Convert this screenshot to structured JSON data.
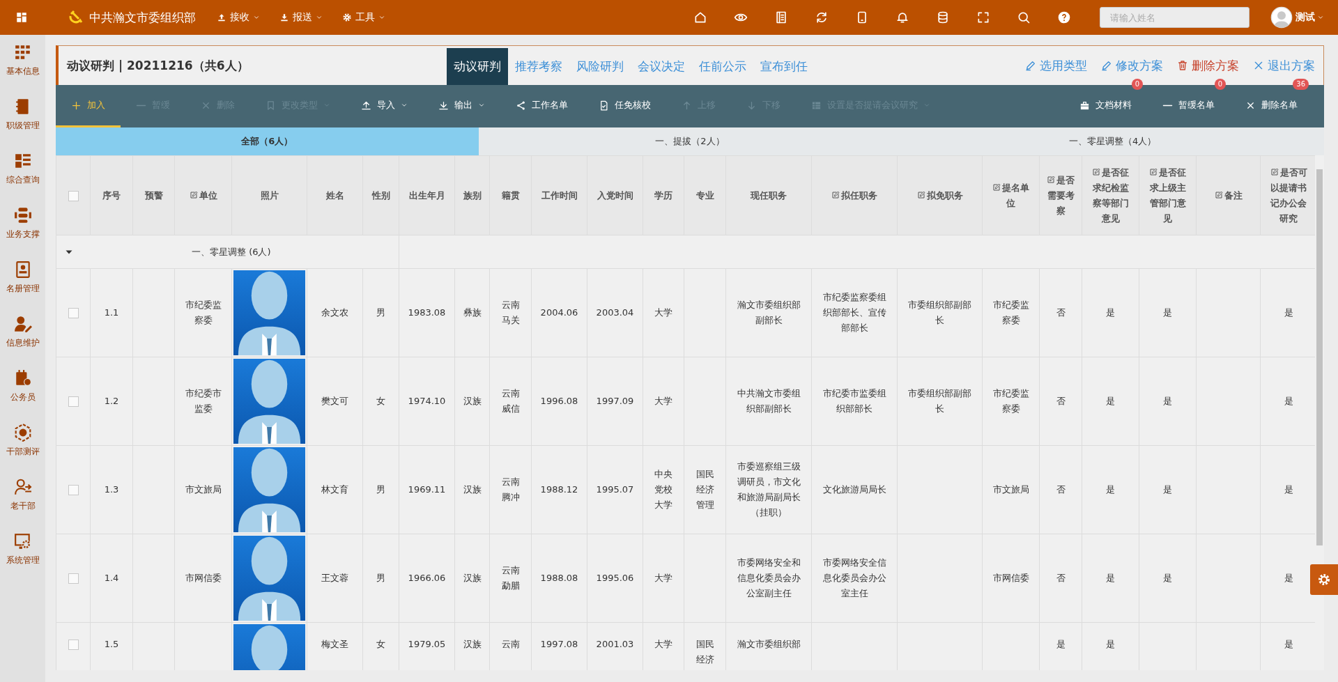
{
  "app": {
    "title": "中共瀚文市委组织部",
    "menus": [
      {
        "label": "接收"
      },
      {
        "label": "报送"
      },
      {
        "label": "工具"
      }
    ],
    "search": {
      "placeholder": "请输入姓名"
    },
    "user": {
      "name": "测试"
    }
  },
  "sidebar": {
    "items": [
      {
        "label": "基本信息"
      },
      {
        "label": "职级管理"
      },
      {
        "label": "综合查询"
      },
      {
        "label": "业务支撑"
      },
      {
        "label": "名册管理"
      },
      {
        "label": "信息维护"
      },
      {
        "label": "公务员"
      },
      {
        "label": "干部测评"
      },
      {
        "label": "老干部"
      },
      {
        "label": "系统管理"
      }
    ]
  },
  "plan": {
    "title": "动议研判 | 20211216（共6人）",
    "stages": [
      {
        "label": "动议研判",
        "selected": true
      },
      {
        "label": "推荐考察",
        "selected": false
      },
      {
        "label": "风险研判",
        "selected": false
      },
      {
        "label": "会议决定",
        "selected": false
      },
      {
        "label": "任前公示",
        "selected": false
      },
      {
        "label": "宣布到任",
        "selected": false
      }
    ],
    "actions": [
      {
        "label": "选用类型",
        "kind": "normal"
      },
      {
        "label": "修改方案",
        "kind": "normal"
      },
      {
        "label": "删除方案",
        "kind": "danger"
      },
      {
        "label": "退出方案",
        "kind": "normal"
      }
    ]
  },
  "toolbar": {
    "items": [
      {
        "label": "加入",
        "selected": true,
        "disabled": false,
        "dropdown": false
      },
      {
        "label": "暂缓",
        "selected": false,
        "disabled": true,
        "dropdown": false
      },
      {
        "label": "删除",
        "selected": false,
        "disabled": true,
        "dropdown": false
      },
      {
        "label": "更改类型",
        "selected": false,
        "disabled": true,
        "dropdown": true
      },
      {
        "label": "导入",
        "selected": false,
        "disabled": false,
        "dropdown": true
      },
      {
        "label": "输出",
        "selected": false,
        "disabled": false,
        "dropdown": true
      },
      {
        "label": "工作名单",
        "selected": false,
        "disabled": false,
        "dropdown": false
      },
      {
        "label": "任免核校",
        "selected": false,
        "disabled": false,
        "dropdown": false
      },
      {
        "label": "上移",
        "selected": false,
        "disabled": true,
        "dropdown": false
      },
      {
        "label": "下移",
        "selected": false,
        "disabled": true,
        "dropdown": false
      },
      {
        "label": "设置是否提请会议研究",
        "selected": false,
        "disabled": true,
        "dropdown": true
      },
      {
        "label": "文档材料",
        "selected": false,
        "disabled": false,
        "dropdown": false,
        "badge": "0"
      },
      {
        "label": "暂缓名单",
        "selected": false,
        "disabled": false,
        "dropdown": false,
        "badge": "0"
      },
      {
        "label": "删除名单",
        "selected": false,
        "disabled": false,
        "dropdown": false,
        "badge": "36"
      }
    ]
  },
  "group_tabs": [
    {
      "label": "全部（6人）",
      "selected": true
    },
    {
      "label": "一、提拔（2人）",
      "selected": false
    },
    {
      "label": "一、零星调整（4人）",
      "selected": false
    }
  ],
  "table": {
    "header_checked": false,
    "columns": [
      {
        "label": "序号",
        "editable": false,
        "kind": "text"
      },
      {
        "label": "预警",
        "editable": false,
        "kind": "text"
      },
      {
        "label": "单位",
        "editable": true,
        "kind": "text"
      },
      {
        "label": "照片",
        "editable": false,
        "kind": "photo"
      },
      {
        "label": "姓名",
        "editable": false,
        "kind": "text"
      },
      {
        "label": "性别",
        "editable": false,
        "kind": "text"
      },
      {
        "label": "出生年月",
        "editable": false,
        "kind": "text"
      },
      {
        "label": "族别",
        "editable": false,
        "kind": "text"
      },
      {
        "label": "籍贯",
        "editable": false,
        "kind": "text"
      },
      {
        "label": "工作时间",
        "editable": false,
        "kind": "text"
      },
      {
        "label": "入党时间",
        "editable": false,
        "kind": "text"
      },
      {
        "label": "学历",
        "editable": false,
        "kind": "text"
      },
      {
        "label": "专业",
        "editable": false,
        "kind": "text"
      },
      {
        "label": "现任职务",
        "editable": false,
        "kind": "text"
      },
      {
        "label": "拟任职务",
        "editable": true,
        "kind": "text"
      },
      {
        "label": "拟免职务",
        "editable": true,
        "kind": "text"
      },
      {
        "label": "提名单位",
        "editable": true,
        "kind": "text"
      },
      {
        "label": "是否需要考察",
        "editable": true,
        "kind": "text"
      },
      {
        "label": "是否征求纪检监察等部门意见",
        "editable": true,
        "kind": "text"
      },
      {
        "label": "是否征求上级主管部门意见",
        "editable": true,
        "kind": "text"
      },
      {
        "label": "备注",
        "editable": true,
        "kind": "text"
      },
      {
        "label": "是否可以提请书记办公会研究",
        "editable": true,
        "kind": "text"
      }
    ],
    "groups": [
      {
        "label": "一、零星调整 (6人)",
        "expanded": true,
        "rows": [
          {
            "checked": false,
            "cells": [
              "1.1",
              null,
              "市纪委监察委",
              null,
              "余文农",
              "男",
              "1983.08",
              "彝族",
              "云南马关",
              "2004.06",
              "2003.04",
              "大学",
              null,
              "瀚文市委组织部副部长",
              "市纪委监察委组织部部长、宣传部部长",
              "市委组织部副部长",
              "市纪委监察委",
              "否",
              "是",
              "是",
              null,
              "是"
            ]
          },
          {
            "checked": false,
            "cells": [
              "1.2",
              null,
              "市纪委市监委",
              null,
              "樊文可",
              "女",
              "1974.10",
              "汉族",
              "云南威信",
              "1996.08",
              "1997.09",
              "大学",
              null,
              "中共瀚文市委组织部副部长",
              "市纪委市监委组织部部长",
              "市委组织部副部长",
              "市纪委监察委",
              "否",
              "是",
              "是",
              null,
              "是"
            ]
          },
          {
            "checked": false,
            "cells": [
              "1.3",
              null,
              "市文旅局",
              null,
              "林文育",
              "男",
              "1969.11",
              "汉族",
              "云南腾冲",
              "1988.12",
              "1995.07",
              "中央党校大学",
              "国民经济管理",
              "市委巡察组三级调研员，市文化和旅游局副局长（挂职）",
              "文化旅游局局长",
              null,
              "市文旅局",
              "否",
              "是",
              "是",
              null,
              "是"
            ]
          },
          {
            "checked": false,
            "cells": [
              "1.4",
              null,
              "市网信委",
              null,
              "王文蓉",
              "男",
              "1966.06",
              "汉族",
              "云南勐腊",
              "1988.08",
              "1995.06",
              "大学",
              null,
              "市委网络安全和信息化委员会办公室副主任",
              "市委网络安全信息化委员会办公室主任",
              null,
              "市网信委",
              "否",
              "是",
              "是",
              null,
              "是"
            ]
          },
          {
            "checked": false,
            "cells": [
              "1.5",
              null,
              null,
              null,
              "梅文圣",
              "女",
              "1979.05",
              "汉族",
              "云南",
              "1997.08",
              "2001.03",
              "大学",
              "国民经济",
              "瀚文市委组织部",
              null,
              null,
              null,
              "是",
              "是",
              null,
              null,
              "是"
            ]
          }
        ]
      }
    ]
  }
}
